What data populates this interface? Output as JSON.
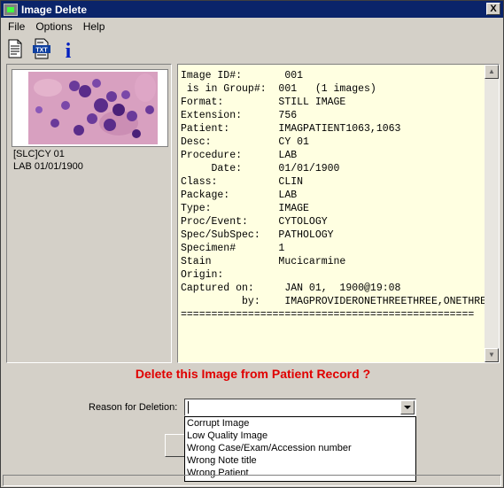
{
  "window": {
    "title": "Image Delete",
    "close_label": "X"
  },
  "menu": [
    "File",
    "Options",
    "Help"
  ],
  "toolbar": [
    {
      "icon": "document-icon"
    },
    {
      "icon": "txt-file-icon",
      "label": "TXT"
    },
    {
      "icon": "info-icon",
      "label": "i"
    }
  ],
  "thumbnail": {
    "caption_line1": "[SLC]CY 01",
    "caption_line2": "LAB  01/01/1900"
  },
  "details": {
    "lines": [
      "Image ID#:       001",
      " is in Group#:  001   (1 images)",
      "Format:         STILL IMAGE",
      "Extension:      756",
      "Patient:        IMAGPATIENT1063,1063",
      "Desc:           CY 01",
      "Procedure:      LAB",
      "     Date:      01/01/1900",
      "Class:          CLIN",
      "Package:        LAB",
      "Type:           IMAGE",
      "Proc/Event:     CYTOLOGY",
      "Spec/SubSpec:   PATHOLOGY",
      "Specimen#       1",
      "Stain           Mucicarmine",
      "Origin:",
      "Captured on:     JAN 01,  1900@19:08",
      "          by:    IMAGPROVIDERONETHREETHREE,ONETHREE",
      "================================================"
    ]
  },
  "confirm_text": "Delete this Image from Patient Record ?",
  "reason": {
    "label": "Reason for Deletion:",
    "value": "",
    "options": [
      "Corrupt Image",
      "Low Quality Image",
      "Wrong Case/Exam/Accession number",
      "Wrong Note title",
      "Wrong Patient"
    ]
  },
  "colors": {
    "titlebar": "#0a246a",
    "confirm_text": "#e00000",
    "details_bg": "#ffffe1"
  }
}
